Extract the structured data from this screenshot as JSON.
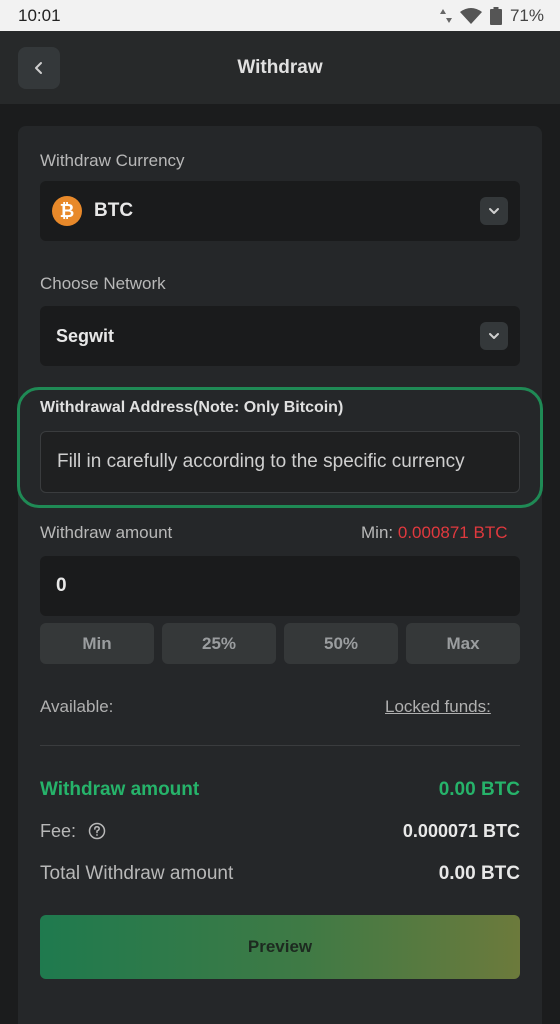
{
  "status_bar": {
    "time": "10:01",
    "battery": "71%"
  },
  "header": {
    "title": "Withdraw"
  },
  "currency": {
    "label": "Withdraw Currency",
    "value": "BTC",
    "coin_glyph": "₿"
  },
  "network": {
    "label": "Choose Network",
    "value": "Segwit"
  },
  "address": {
    "label": "Withdrawal Address(Note: Only Bitcoin)",
    "placeholder": "Fill in carefully according to the specific currency"
  },
  "amount": {
    "label": "Withdraw amount",
    "min_label": "Min:",
    "min_value": "0.000871 BTC",
    "value": "0",
    "quick": [
      "Min",
      "25%",
      "50%",
      "Max"
    ]
  },
  "available": {
    "label": "Available:",
    "locked_label": "Locked funds:"
  },
  "summary": {
    "withdraw_label": "Withdraw amount",
    "withdraw_value": "0.00 BTC",
    "fee_label": "Fee:",
    "fee_value": "0.000071 BTC",
    "total_label": "Total Withdraw amount",
    "total_value": "0.00 BTC"
  },
  "preview_label": "Preview",
  "colors": {
    "accent_green": "#26b36a",
    "min_red": "#e0393e",
    "highlight_border": "#1f8a55"
  }
}
